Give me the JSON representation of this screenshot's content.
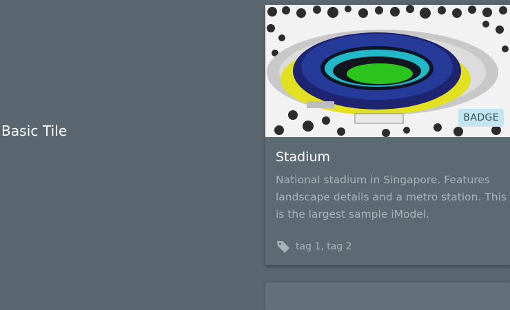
{
  "section": {
    "label": "Basic Tile"
  },
  "tile": {
    "badge": "BADGE",
    "title": "Stadium",
    "description": "National stadium in Singapore. Features landscape details and a metro station. This is the largest sample iModel.",
    "tags": "tag 1, tag 2",
    "tag_icon": "tag-icon",
    "thumbnail": "stadium-image"
  },
  "colors": {
    "background": "#5a6770",
    "tile_background": "#5c6a74",
    "badge_background": "#c3e5f3",
    "muted_text": "#a9b2b8"
  }
}
